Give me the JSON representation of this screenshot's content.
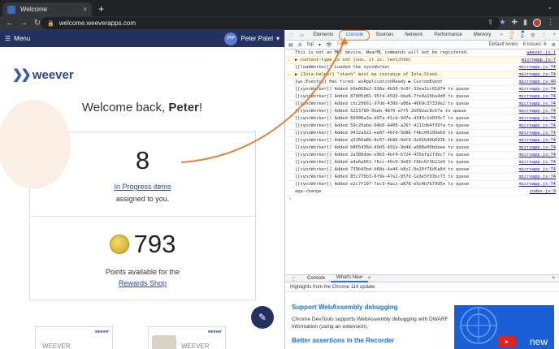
{
  "browser": {
    "tab_title": "Welcome",
    "tab_close": "×",
    "new_tab": "+",
    "url": "welcome.weeverapps.com"
  },
  "app": {
    "menu_label": "Menu",
    "user_initials": "PP",
    "user_name": "Peter Patel",
    "logo_text": "weever",
    "welcome_prefix": "Welcome back, ",
    "welcome_name": "Peter",
    "welcome_suffix": "!",
    "in_progress_count": "8",
    "in_progress_link": "In Progress items",
    "assigned_text": "assigned to you.",
    "points_count": "793",
    "points_text": "Points available for the",
    "rewards_link": "Rewards Shop",
    "thumb1_text": "WEEVER",
    "thumb2_text": "WEEVER"
  },
  "devtools": {
    "tabs": [
      "Elements",
      "Console",
      "Sources",
      "Network",
      "Performance",
      "Memory"
    ],
    "active_tab": "Console",
    "more": "»",
    "warn_badge": "2",
    "info_badge": "6",
    "context": "top",
    "filter_placeholder": "Filter",
    "levels": "Default levels",
    "issues": "6 Issues: ",
    "issues_count": "6",
    "logs": [
      {
        "type": "info",
        "msg": "This is not an MMT device, WearML commands will not be registered.",
        "src": "weever.js:1"
      },
      {
        "type": "warn",
        "msg": "▶ content-type is not json, it is: text/html",
        "src": "microapp.js:7"
      },
      {
        "type": "info",
        "msg": "[[loadWorker]] Loaded the syncWorker",
        "src": "microapp.js:74"
      },
      {
        "type": "warn",
        "msg": "▶ [Iota.helper] \"stash\" must be instance of Iota.Stash.",
        "src": "microapp.js:74"
      },
      {
        "type": "info",
        "msg": "[wx.Events]] Has fired: wxApplicationReady  ▶ CustomEvent",
        "src": "microapp.js:40"
      },
      {
        "type": "info",
        "msg": "[[syncWorker]] Added b9e868e2-938a-4b56-9c0f-33ea1cc01d74 to queue",
        "src": "microapp.js:74"
      },
      {
        "type": "info",
        "msg": "[[syncWorker]] Added 87805d81-95f4-4593-bbe6-7fe9a16ba4d0 to queue",
        "src": "microapp.js:74"
      },
      {
        "type": "info",
        "msg": "[[syncWorker]] Added cbc20661-97dd-430d-a86a-4669c37339e2 to queue",
        "src": "microapp.js:74"
      },
      {
        "type": "info",
        "msg": "[[syncWorker]] Added 5253780-0beb-4870-a7f5-2b092ac8c67a to queue",
        "src": "microapp.js:74"
      },
      {
        "type": "info",
        "msg": "[[syncWorker]] Added 66406a3a-b97a-41cd-947e-d343c1d093c7 to queue",
        "src": "microapp.js:74"
      },
      {
        "type": "info",
        "msg": "[[syncWorker]] Added 59c26abe-94b0-4400-a26f-4211db4f39fa to queue",
        "src": "microapp.js:74"
      },
      {
        "type": "info",
        "msg": "[[syncWorker]] Added 9432a021-ee87-46fd-9d86-f4bc00199a69 to queue",
        "src": "microapp.js:74"
      },
      {
        "type": "info",
        "msg": "[[syncWorker]] Added a3366a8b-8c67-4b96-8df9-3e91b99b6936 to queue",
        "src": "microapp.js:74"
      },
      {
        "type": "info",
        "msg": "[[syncWorker]] Added b865d38d-49d3-491e-9e44-a688e00bbbee to queue",
        "src": "microapp.js:74"
      },
      {
        "type": "info",
        "msg": "[[syncWorker]] Added 2a389dde-e9b3-4bf4-b724-455bfa2f3bc7 to queue",
        "src": "microapp.js:74"
      },
      {
        "type": "info",
        "msg": "[[syncWorker]] Added e4e6a661-f6cc-40c9-9e63-f6bc6f3b21d4 to queue",
        "src": "microapp.js:74"
      },
      {
        "type": "info",
        "msg": "[[syncWorker]] Added 739b45bd-b68e-4a44-b8c2-0e20f76d5a8d to queue",
        "src": "microapp.js:74"
      },
      {
        "type": "info",
        "msg": "[[syncWorker]] Added 85c770b3-6f9e-47e2-957d-1e3e5f03bc73 to queue",
        "src": "microapp.js:74"
      },
      {
        "type": "info",
        "msg": "[[syncWorker]] Added e2c7f197-7ec3-4acc-a878-e5c4b7b7995e to queue",
        "src": "microapp.js:74"
      },
      {
        "type": "info",
        "msg": "app-change",
        "src": "index.js:9"
      }
    ],
    "prompt": "›",
    "drawer_tabs": [
      "Console",
      "What's New"
    ],
    "drawer_close": "×",
    "highlights": "Highlights from the Chrome 114 update",
    "wn_title1": "Support WebAssembly debugging",
    "wn_text1": "Chrome DevTools supports WebAssembly debugging with DWARF information (using an extension).",
    "wn_title2": "Better assertions in the Recorder",
    "promo_text": "new"
  },
  "colors": {
    "appbar": "#22315e",
    "accent": "#1a73e8",
    "highlight_ring": "#e57b2e"
  }
}
